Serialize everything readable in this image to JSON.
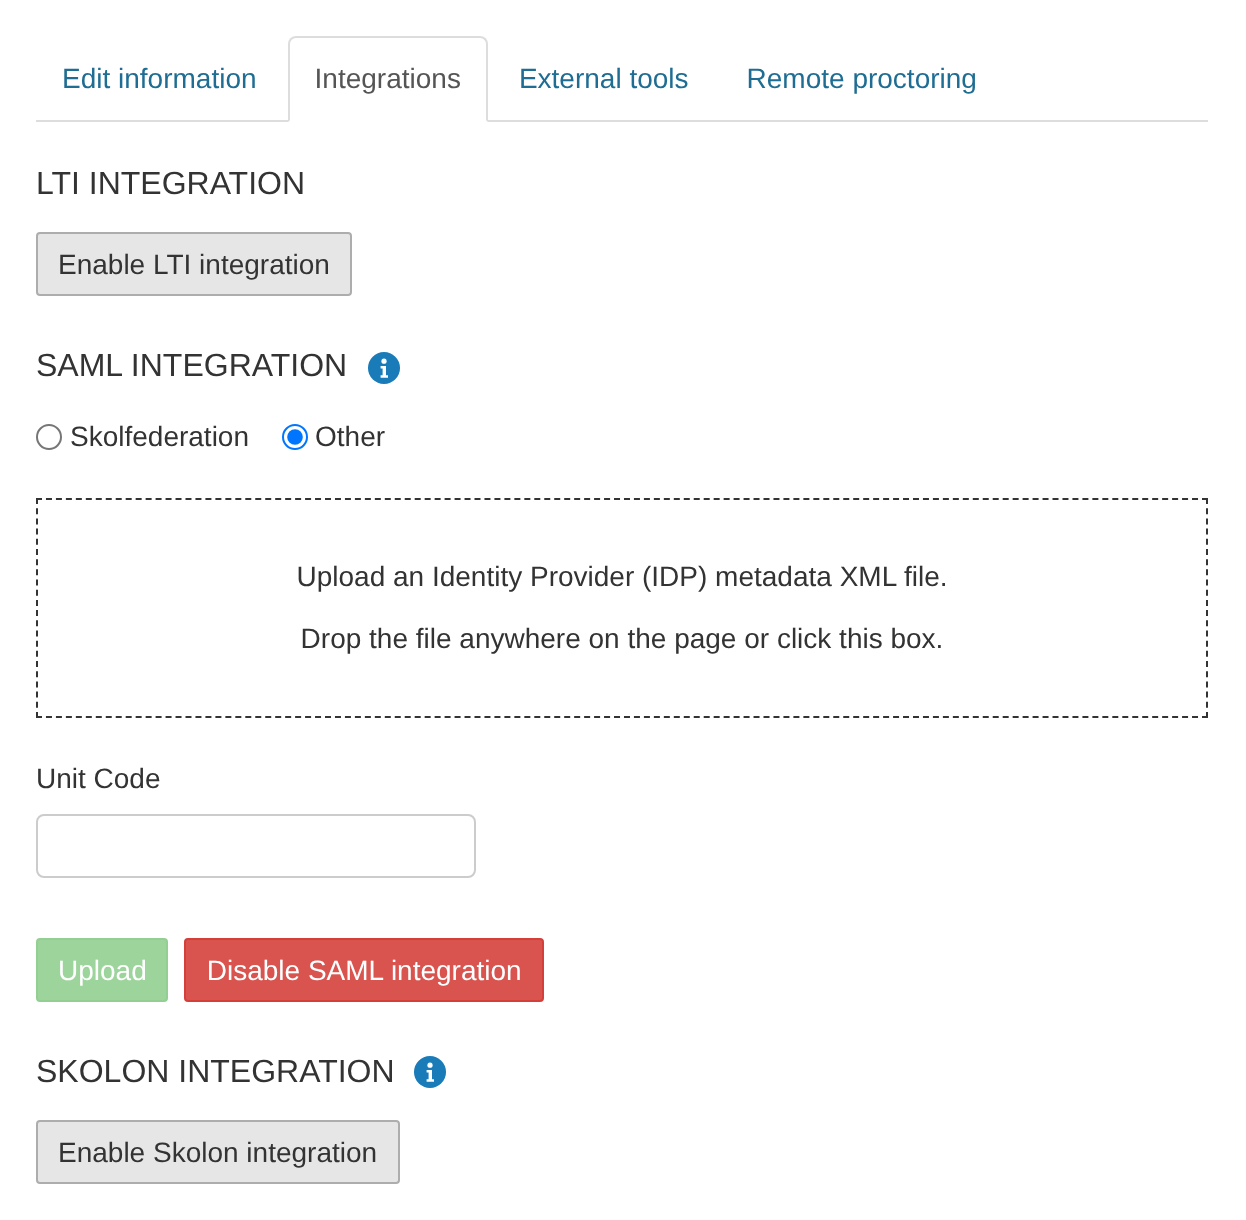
{
  "tabs": [
    {
      "label": "Edit information",
      "selected": false
    },
    {
      "label": "Integrations",
      "selected": true
    },
    {
      "label": "External tools",
      "selected": false
    },
    {
      "label": "Remote proctoring",
      "selected": false
    }
  ],
  "sections": [
    {
      "title": "LTI INTEGRATION",
      "info": false,
      "buttons": [
        {
          "label": "Enable LTI integration",
          "kind": "default",
          "disabled": false
        }
      ]
    },
    {
      "title": "SAML INTEGRATION",
      "info": true,
      "options": [
        {
          "label": "Skolfederation",
          "selected": false
        },
        {
          "label": "Other",
          "selected": true
        }
      ],
      "dropzone": {
        "lines": [
          "Upload an Identity Provider (IDP) metadata XML file.",
          "Drop the file anywhere on the page or click this box."
        ]
      },
      "field": {
        "label": "Unit Code"
      },
      "buttons": [
        {
          "label": "Upload",
          "kind": "success",
          "disabled": true
        },
        {
          "label": "Disable SAML integration",
          "kind": "danger",
          "disabled": false
        }
      ]
    },
    {
      "title": "SKOLON INTEGRATION",
      "info": true,
      "buttons": [
        {
          "label": "Enable Skolon integration",
          "kind": "default",
          "disabled": false
        }
      ]
    }
  ]
}
